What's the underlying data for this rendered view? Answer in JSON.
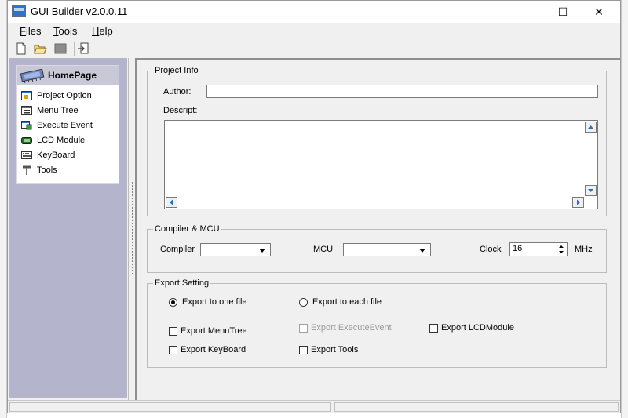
{
  "window": {
    "title": "GUI Builder v2.0.0.11",
    "controls": {
      "minimize": "—",
      "maximize": "☐",
      "close": "✕"
    }
  },
  "menubar": [
    {
      "label": "Files",
      "mnemonic": "F",
      "rest": "iles"
    },
    {
      "label": "Tools",
      "mnemonic": "T",
      "rest": "ools"
    },
    {
      "label": "Help",
      "mnemonic": "H",
      "rest": "elp"
    }
  ],
  "toolbar": [
    "new-file-icon",
    "open-folder-icon",
    "save-icon",
    "export-icon"
  ],
  "nav": {
    "header": "HomePage",
    "items": [
      {
        "label": "Project Option",
        "icon": "project-option-icon"
      },
      {
        "label": "Menu Tree",
        "icon": "menu-tree-icon"
      },
      {
        "label": "Execute Event",
        "icon": "execute-event-icon"
      },
      {
        "label": "LCD Module",
        "icon": "lcd-module-icon"
      },
      {
        "label": "KeyBoard",
        "icon": "keyboard-icon"
      },
      {
        "label": "Tools",
        "icon": "tools-icon"
      }
    ]
  },
  "project_info": {
    "legend": "Project Info",
    "author_label": "Author:",
    "author_value": "",
    "descript_label": "Descript:",
    "descript_value": ""
  },
  "compiler_mcu": {
    "legend": "Compiler & MCU",
    "compiler_label": "Compiler",
    "compiler_value": "",
    "mcu_label": "MCU",
    "mcu_value": "",
    "clock_label": "Clock",
    "clock_value": "16",
    "clock_unit": "MHz"
  },
  "export": {
    "legend": "Export Setting",
    "radio_one": "Export to one file",
    "radio_each": "Export to each file",
    "selected": "Export to one file",
    "checks": {
      "menutree": {
        "label": "Export MenuTree",
        "checked": false,
        "enabled": true
      },
      "executeevent": {
        "label": "Export ExecuteEvent",
        "checked": false,
        "enabled": false
      },
      "lcdmodule": {
        "label": "Export LCDModule",
        "checked": false,
        "enabled": true
      },
      "keyboard": {
        "label": "Export KeyBoard",
        "checked": false,
        "enabled": true
      },
      "tools": {
        "label": "Export Tools",
        "checked": false,
        "enabled": true
      }
    }
  },
  "colors": {
    "nav_panel": "#b4b4cd",
    "window_bg": "#f0f0f0"
  }
}
